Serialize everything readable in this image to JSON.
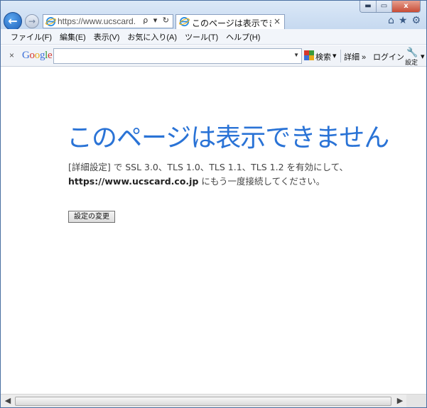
{
  "browser": {
    "address_url": "https://www.ucscard.co.jp/",
    "address_tools": "ρ ▾ ↻",
    "tab_title": "このページは表示できま...",
    "tab_close": "×",
    "window_buttons": {
      "minimize": "▬",
      "maximize": "▭",
      "close": "x"
    },
    "right_icons": {
      "home": "⌂",
      "favorites": "★",
      "tools": "⚙"
    }
  },
  "menubar": [
    "ファイル(F)",
    "編集(E)",
    "表示(V)",
    "お気に入り(A)",
    "ツール(T)",
    "ヘルプ(H)"
  ],
  "google_toolbar": {
    "close": "×",
    "logo_letters": [
      "G",
      "o",
      "o",
      "g",
      "l",
      "e"
    ],
    "logo_colors": [
      "#3b6fd8",
      "#d6372c",
      "#e8a919",
      "#3b6fd8",
      "#3a9a3a",
      "#d6372c"
    ],
    "search_value": "",
    "search_button": "検索",
    "more": "詳細 »",
    "login": "ログイン",
    "settings": "設定"
  },
  "page": {
    "heading": "このページは表示できません",
    "message_line1": "[詳細設定] で SSL 3.0、TLS 1.0、TLS 1.1、TLS 1.2 を有効にして、",
    "message_url": "https://www.ucscard.co.jp",
    "message_line2_suffix": " にもう一度接続してください。",
    "change_settings_button": "設定の変更"
  },
  "colors": {
    "heading": "#2a73d6",
    "accent_blue": "#1d5fb8"
  }
}
